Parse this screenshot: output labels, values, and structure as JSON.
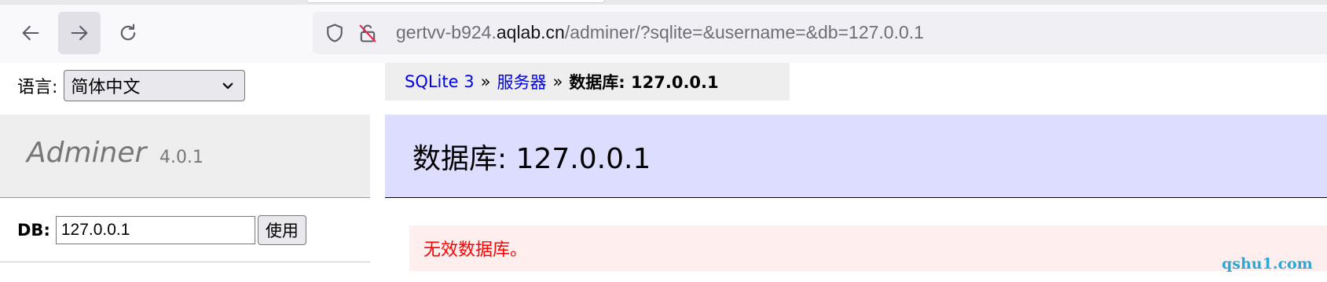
{
  "browser": {
    "url_prefix": "gertvv-b924.",
    "url_host": "aqlab.cn",
    "url_path": "/adminer/?sqlite=&username=&db=127.0.0.1",
    "icons": [
      "back-arrow-icon",
      "forward-arrow-icon",
      "reload-icon",
      "shield-icon",
      "insecure-lock-icon"
    ]
  },
  "sidebar": {
    "language_label": "语言:",
    "language_selected": "简体中文",
    "app_name": "Adminer",
    "app_version": "4.0.1",
    "db_label": "DB:",
    "db_value": "127.0.0.1",
    "use_button": "使用"
  },
  "breadcrumb": {
    "driver": "SQLite 3",
    "sep1": "»",
    "server": "服务器",
    "sep2": "»",
    "current": "数据库: 127.0.0.1"
  },
  "main": {
    "heading": "数据库: 127.0.0.1",
    "error": "无效数据库。"
  },
  "watermark": "qshu1.com",
  "colors": {
    "link": "#0000ee",
    "heading_bg": "#ddddff",
    "error_bg": "#ffeeee",
    "error_text": "#ff0000",
    "watermark": "#2aa8d8"
  }
}
